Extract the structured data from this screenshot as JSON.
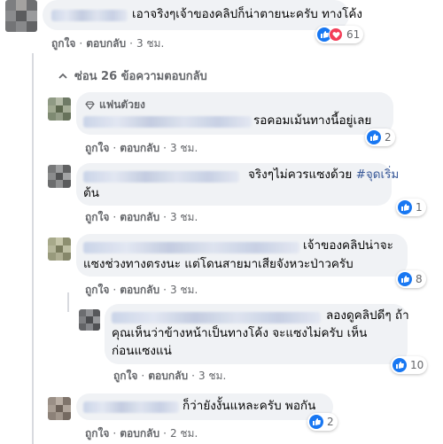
{
  "actions": {
    "like": "ถูกใจ",
    "reply": "ตอบกลับ",
    "separator": "·"
  },
  "icons": {
    "like": "like-icon",
    "love": "love-icon",
    "chevron": "chevron-up-icon",
    "fan": "diamond-icon"
  },
  "colors": {
    "like_blue": "#1877f2",
    "love_red": "#f33e58",
    "bubble": "#f0f2f5",
    "meta_gray": "#65676b"
  },
  "top_comment": {
    "text": "เอาจริงๆเจ้าของคลิปก็น่าตายนะครับ ทางโค้ง",
    "time": "3 ชม.",
    "reaction_count": "61"
  },
  "replies_toggle": {
    "label": "ซ่อน 26 ข้อความตอบกลับ"
  },
  "replies": [
    {
      "badge": "แฟนตัวยง",
      "text": "รอคอมเม้นทางนี้อยู่เลย",
      "time": "3 ชม.",
      "reaction_count": "2"
    },
    {
      "text_line1": "จริงๆไม่ควรแซงด้วย ",
      "hashtag": "#จุดเริ่ม",
      "text_line2": "ต้น",
      "time": "3 ชม.",
      "reaction_count": "1"
    },
    {
      "text_line1": "เจ้าของคลิปน่าจะ",
      "text_line2": "แซงช่วงทางตรงนะ แต่โดนสายมาเสียจังหวะป่าวครับ",
      "time": "3 ชม.",
      "reaction_count": "8"
    },
    {
      "text_line1": "ลองดูคลิปดีๆ ถ้า",
      "text_line2": "คุณเห็นว่าข้างหน้าเป็นทางโค้ง จะแซงไม่ครับ เห็น",
      "text_line3": "ก่อนแซงแน่",
      "time": "3 ชม.",
      "reaction_count": "10"
    },
    {
      "text": "ก็ว่ายังงั้นแหละครับ พอกัน",
      "time": "2 ชม.",
      "reaction_count": "2"
    }
  ]
}
